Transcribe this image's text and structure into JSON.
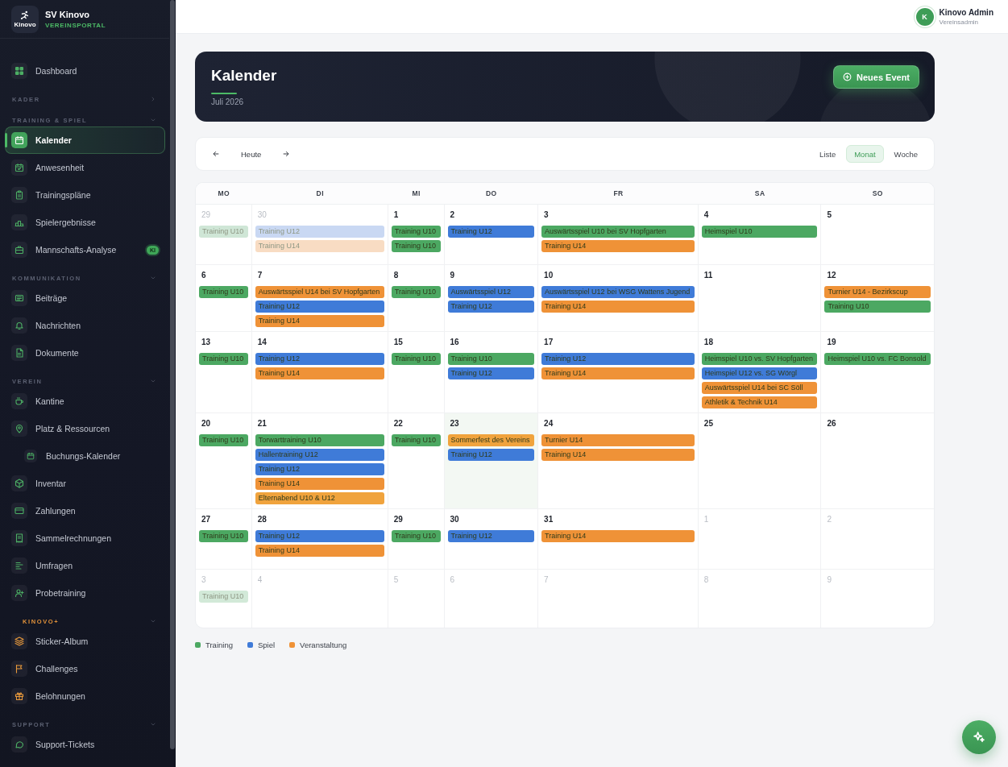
{
  "sidebar": {
    "brand": {
      "logo_text": "Kinovo",
      "name": "SV Kinovo",
      "subtitle": "VEREINSPORTAL"
    },
    "top_items": [
      {
        "label": "Dashboard",
        "selected": false
      }
    ],
    "sections": [
      {
        "title": "KADER",
        "kind": "standard",
        "expanded": false
      },
      {
        "title": "TRAINING & SPIEL",
        "kind": "standard",
        "expanded": true,
        "items": [
          {
            "label": "Kalender",
            "selected": true
          },
          {
            "label": "Anwesenheit",
            "selected": false
          },
          {
            "label": "Trainingspläne",
            "selected": false
          },
          {
            "label": "Spielergebnisse",
            "selected": false
          },
          {
            "label": "Mannschafts-Analyse",
            "selected": false,
            "badge": "KI"
          }
        ]
      },
      {
        "title": "KOMMUNIKATION",
        "kind": "standard",
        "expanded": true,
        "items": [
          {
            "label": "Beiträge",
            "selected": false
          },
          {
            "label": "Nachrichten",
            "selected": false
          },
          {
            "label": "Dokumente",
            "selected": false
          }
        ]
      },
      {
        "title": "VEREIN",
        "kind": "standard",
        "expanded": true,
        "items": [
          {
            "label": "Kantine",
            "selected": false
          },
          {
            "label": "Platz & Ressourcen",
            "selected": false,
            "children": [
              {
                "label": "Buchungs-Kalender",
                "selected": false
              }
            ]
          },
          {
            "label": "Inventar",
            "selected": false
          },
          {
            "label": "Zahlungen",
            "selected": false
          },
          {
            "label": "Sammelrechnungen",
            "selected": false
          },
          {
            "label": "Umfragen",
            "selected": false
          },
          {
            "label": "Probetraining",
            "selected": false
          }
        ]
      },
      {
        "title": "KINOVO+",
        "kind": "premium",
        "expanded": true,
        "items": [
          {
            "label": "Sticker-Album",
            "selected": false
          },
          {
            "label": "Challenges",
            "selected": false
          },
          {
            "label": "Belohnungen",
            "selected": false
          }
        ]
      },
      {
        "title": "SUPPORT",
        "kind": "standard",
        "expanded": true,
        "items": [
          {
            "label": "Support-Tickets",
            "selected": false
          }
        ]
      }
    ]
  },
  "top_bar": {
    "user": {
      "initial": "K",
      "name": "Kinovo Admin",
      "role": "Vereinsadmin"
    }
  },
  "header": {
    "title": "Kalender",
    "subtitle": "Juli 2026",
    "button": "Neues Event"
  },
  "toolbar": {
    "today_button": "Heute",
    "views": [
      {
        "label": "Liste",
        "selected": false
      },
      {
        "label": "Monat",
        "selected": true
      },
      {
        "label": "Woche",
        "selected": false
      }
    ]
  },
  "calendar": {
    "weekdays": [
      "MO",
      "DI",
      "MI",
      "DO",
      "FR",
      "SA",
      "SO"
    ],
    "weeks": [
      {
        "days": [
          {
            "day": "29",
            "other_month": true,
            "today": false,
            "events": [
              {
                "title": "Training U10",
                "color": "#cfe6d6"
              }
            ]
          },
          {
            "day": "30",
            "other_month": true,
            "today": false,
            "events": [
              {
                "title": "Training U12",
                "color": "#c9d8f3"
              },
              {
                "title": "Training U14",
                "color": "#f8dcc3"
              }
            ]
          },
          {
            "day": "1",
            "other_month": false,
            "today": false,
            "events": [
              {
                "title": "Training U10",
                "color": "#4ca862"
              },
              {
                "title": "Training U10",
                "color": "#4ca862"
              }
            ]
          },
          {
            "day": "2",
            "other_month": false,
            "today": false,
            "events": [
              {
                "title": "Training U12",
                "color": "#3f7bd8"
              }
            ]
          },
          {
            "day": "3",
            "other_month": false,
            "today": false,
            "events": [
              {
                "title": "Auswärtsspiel U10 bei SV Hopfgarten",
                "color": "#4ca862"
              },
              {
                "title": "Training U14",
                "color": "#ef9237"
              }
            ]
          },
          {
            "day": "4",
            "other_month": false,
            "today": false,
            "events": [
              {
                "title": "Heimspiel U10",
                "color": "#4ca862"
              }
            ]
          },
          {
            "day": "5",
            "other_month": false,
            "today": false
          }
        ]
      },
      {
        "days": [
          {
            "day": "6",
            "other_month": false,
            "today": false,
            "events": [
              {
                "title": "Training U10",
                "color": "#4ca862"
              }
            ]
          },
          {
            "day": "7",
            "other_month": false,
            "today": false,
            "events": [
              {
                "title": "Auswärtsspiel U14 bei SV Hopfgarten",
                "color": "#ef9237"
              },
              {
                "title": "Training U12",
                "color": "#3f7bd8"
              },
              {
                "title": "Training U14",
                "color": "#ef9237"
              }
            ]
          },
          {
            "day": "8",
            "other_month": false,
            "today": false,
            "events": [
              {
                "title": "Training U10",
                "color": "#4ca862"
              }
            ]
          },
          {
            "day": "9",
            "other_month": false,
            "today": false,
            "events": [
              {
                "title": "Auswärtsspiel U12",
                "color": "#3f7bd8"
              },
              {
                "title": "Training U12",
                "color": "#3f7bd8"
              }
            ]
          },
          {
            "day": "10",
            "other_month": false,
            "today": false,
            "events": [
              {
                "title": "Auswärtsspiel U12 bei WSG Wattens Jugend",
                "color": "#3f7bd8"
              },
              {
                "title": "Training U14",
                "color": "#ef9237"
              }
            ]
          },
          {
            "day": "11",
            "other_month": false,
            "today": false
          },
          {
            "day": "12",
            "other_month": false,
            "today": false,
            "events": [
              {
                "title": "Turnier U14 - Bezirkscup",
                "color": "#ef9237"
              },
              {
                "title": "Training U10",
                "color": "#4ca862"
              }
            ]
          }
        ]
      },
      {
        "days": [
          {
            "day": "13",
            "other_month": false,
            "today": false,
            "events": [
              {
                "title": "Training U10",
                "color": "#4ca862"
              }
            ]
          },
          {
            "day": "14",
            "other_month": false,
            "today": false,
            "events": [
              {
                "title": "Training U12",
                "color": "#3f7bd8"
              },
              {
                "title": "Training U14",
                "color": "#ef9237"
              }
            ]
          },
          {
            "day": "15",
            "other_month": false,
            "today": false,
            "events": [
              {
                "title": "Training U10",
                "color": "#4ca862"
              }
            ]
          },
          {
            "day": "16",
            "other_month": false,
            "today": false,
            "events": [
              {
                "title": "Training U10",
                "color": "#4ca862"
              },
              {
                "title": "Training U12",
                "color": "#3f7bd8"
              }
            ]
          },
          {
            "day": "17",
            "other_month": false,
            "today": false,
            "events": [
              {
                "title": "Training U12",
                "color": "#3f7bd8"
              },
              {
                "title": "Training U14",
                "color": "#ef9237"
              }
            ]
          },
          {
            "day": "18",
            "other_month": false,
            "today": false,
            "events": [
              {
                "title": "Heimspiel U10 vs. SV Hopfgarten",
                "color": "#4ca862"
              },
              {
                "title": "Heimspiel U12 vs. SG Wörgl",
                "color": "#3f7bd8"
              },
              {
                "title": "Auswärtsspiel U14 bei SC Söll",
                "color": "#ef9237"
              },
              {
                "title": "Athletik & Technik U14",
                "color": "#ef9237"
              }
            ]
          },
          {
            "day": "19",
            "other_month": false,
            "today": false,
            "events": [
              {
                "title": "Heimspiel U10 vs. FC Bonsold",
                "color": "#4ca862"
              }
            ]
          }
        ]
      },
      {
        "days": [
          {
            "day": "20",
            "other_month": false,
            "today": false,
            "events": [
              {
                "title": "Training U10",
                "color": "#4ca862"
              }
            ]
          },
          {
            "day": "21",
            "other_month": false,
            "today": false,
            "events": [
              {
                "title": "Torwarttraining U10",
                "color": "#4ca862"
              },
              {
                "title": "Hallentraining U12",
                "color": "#3f7bd8"
              },
              {
                "title": "Training U12",
                "color": "#3f7bd8"
              },
              {
                "title": "Training U14",
                "color": "#ef9237"
              },
              {
                "title": "Elternabend U10 & U12",
                "color": "#f0a33d"
              }
            ]
          },
          {
            "day": "22",
            "other_month": false,
            "today": false,
            "events": [
              {
                "title": "Training U10",
                "color": "#4ca862"
              }
            ]
          },
          {
            "day": "23",
            "other_month": false,
            "today": true,
            "events": [
              {
                "title": "Sommerfest des Vereins",
                "color": "#f0a33d"
              },
              {
                "title": "Training U12",
                "color": "#3f7bd8"
              }
            ]
          },
          {
            "day": "24",
            "other_month": false,
            "today": false,
            "events": [
              {
                "title": "Turnier U14",
                "color": "#ef9237"
              },
              {
                "title": "Training U14",
                "color": "#ef9237"
              }
            ]
          },
          {
            "day": "25",
            "other_month": false,
            "today": false
          },
          {
            "day": "26",
            "other_month": false,
            "today": false
          }
        ]
      },
      {
        "days": [
          {
            "day": "27",
            "other_month": false,
            "today": false,
            "events": [
              {
                "title": "Training U10",
                "color": "#4ca862"
              }
            ]
          },
          {
            "day": "28",
            "other_month": false,
            "today": false,
            "events": [
              {
                "title": "Training U12",
                "color": "#3f7bd8"
              },
              {
                "title": "Training U14",
                "color": "#ef9237"
              }
            ]
          },
          {
            "day": "29",
            "other_month": false,
            "today": false,
            "events": [
              {
                "title": "Training U10",
                "color": "#4ca862"
              }
            ]
          },
          {
            "day": "30",
            "other_month": false,
            "today": false,
            "events": [
              {
                "title": "Training U12",
                "color": "#3f7bd8"
              }
            ]
          },
          {
            "day": "31",
            "other_month": false,
            "today": false,
            "events": [
              {
                "title": "Training U14",
                "color": "#ef9237"
              }
            ]
          },
          {
            "day": "1",
            "other_month": true,
            "today": false
          },
          {
            "day": "2",
            "other_month": true,
            "today": false
          }
        ]
      },
      {
        "days": [
          {
            "day": "3",
            "other_month": true,
            "today": false,
            "events": [
              {
                "title": "Training U10",
                "color": "#d2e9d8"
              }
            ]
          },
          {
            "day": "4",
            "other_month": true,
            "today": false
          },
          {
            "day": "5",
            "other_month": true,
            "today": false
          },
          {
            "day": "6",
            "other_month": true,
            "today": false
          },
          {
            "day": "7",
            "other_month": true,
            "today": false
          },
          {
            "day": "8",
            "other_month": true,
            "today": false
          },
          {
            "day": "9",
            "other_month": true,
            "today": false
          }
        ]
      }
    ]
  },
  "legend": [
    {
      "label": "Training",
      "color": "#4ca862"
    },
    {
      "label": "Spiel",
      "color": "#3f7bd8"
    },
    {
      "label": "Veranstaltung",
      "color": "#ef9237"
    }
  ]
}
